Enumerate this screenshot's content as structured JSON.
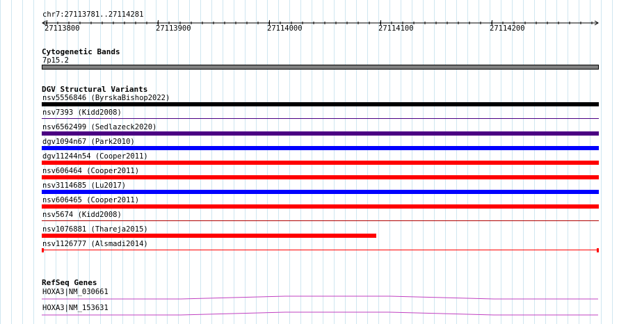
{
  "ruler": {
    "region": "chr7:27113781..27114281",
    "ticks": [
      "27113800",
      "27113900",
      "27114000",
      "27114100",
      "27114200"
    ]
  },
  "cytobands": {
    "title": "Cytogenetic Bands",
    "band": "7p15.2",
    "color": "#808080"
  },
  "dgv": {
    "title": "DGV Structural Variants",
    "variants": [
      {
        "label": "nsv5556846 (ByrskaBishop2022)",
        "color": "#000000",
        "style": "thick"
      },
      {
        "label": "nsv7393 (Kidd2008)",
        "color": "#4b0082",
        "style": "thin"
      },
      {
        "label": "nsv6562499 (Sedlazeck2020)",
        "color": "#4b0082",
        "style": "thick"
      },
      {
        "label": "dgv1094n67 (Park2010)",
        "color": "#0000ff",
        "style": "thick"
      },
      {
        "label": "dgv11244n54 (Cooper2011)",
        "color": "#ff0000",
        "style": "thick"
      },
      {
        "label": "nsv606464 (Cooper2011)",
        "color": "#ff0000",
        "style": "thick"
      },
      {
        "label": "nsv3114685 (Lu2017)",
        "color": "#0000ff",
        "style": "thick"
      },
      {
        "label": "nsv606465 (Cooper2011)",
        "color": "#ff0000",
        "style": "thick"
      },
      {
        "label": "nsv5674 (Kidd2008)",
        "color": "#b00000",
        "style": "thin"
      },
      {
        "label": "nsv1076881 (Thareja2015)",
        "color": "#ff0000",
        "style": "partial",
        "end_fraction": 0.6
      },
      {
        "label": "nsv1126777 (Alsmadi2014)",
        "color": "#ff0000",
        "style": "capped"
      }
    ]
  },
  "refseq": {
    "title": "RefSeq Genes",
    "genes": [
      {
        "label": "HOXA3|NM_030661",
        "color": "#c040c0"
      },
      {
        "label": "HOXA3|NM_153631",
        "color": "#c040c0"
      }
    ]
  }
}
